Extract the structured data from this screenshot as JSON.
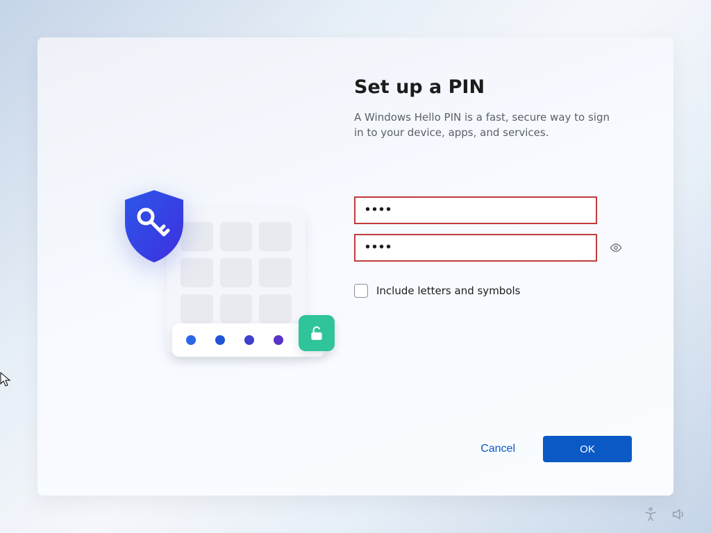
{
  "title": "Set up a PIN",
  "description": "A Windows Hello PIN is a fast, secure way to sign in to your device, apps, and services.",
  "pin_value_masked": "••••",
  "confirm_pin_value_masked": "••••",
  "checkbox_label": "Include letters and symbols",
  "checkbox_checked": false,
  "buttons": {
    "cancel": "Cancel",
    "ok": "OK"
  },
  "error_state": true,
  "colors": {
    "error_border": "#c23a3a",
    "primary": "#0a59c4",
    "accent_green": "#2fc49a"
  },
  "icons": {
    "shield": "shield-key-icon",
    "unlock": "padlock-open-icon",
    "reveal": "eye-icon",
    "accessibility": "accessibility-icon",
    "volume": "speaker-icon"
  }
}
